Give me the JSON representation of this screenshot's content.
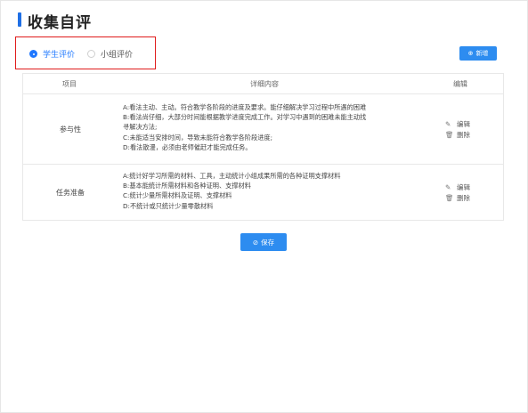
{
  "page": {
    "title": "收集自评"
  },
  "tabs": [
    {
      "label": "学生评价",
      "checked": true
    },
    {
      "label": "小组评价",
      "checked": false
    }
  ],
  "toolbar": {
    "add_label": "新增",
    "add_icon": "plus-circle-icon"
  },
  "table": {
    "columns": [
      "项目",
      "详细内容",
      "编辑"
    ],
    "rows": [
      {
        "item": "参与性",
        "details": [
          "A:看法主动、主动。符合教学各阶段的进度及要求。能仔细解决学习过程中所遇的困难",
          "B:看法尚仔细，大部分时间能根据教学进度完成工作。对学习中遇到的困难未能主动找",
          "寻解决方法;",
          "C:未能适当安排时间，导致未能符合教学各阶段进度;",
          "D:看法散漫，必须由老师催赶才能完成任务。"
        ],
        "edit_label": "编辑",
        "delete_label": "删除"
      },
      {
        "item": "任务准备",
        "details": [
          "A:统计好学习所需的材料、工具，主动统计小组成果所需的各种证明支撑材料",
          "B:基本能统计所需材料和各种证明、支撑材料",
          "C:统计少量所需材料及证明、支撑材料",
          "D:不统计或只统计少量零散材料"
        ],
        "edit_label": "编辑",
        "delete_label": "删除"
      }
    ]
  },
  "footer": {
    "save_label": "保存",
    "save_icon": "check-circle-icon"
  },
  "colors": {
    "accent": "#2d8cf0",
    "title_bar": "#1f6fe5",
    "highlight": "#e01b1b"
  }
}
